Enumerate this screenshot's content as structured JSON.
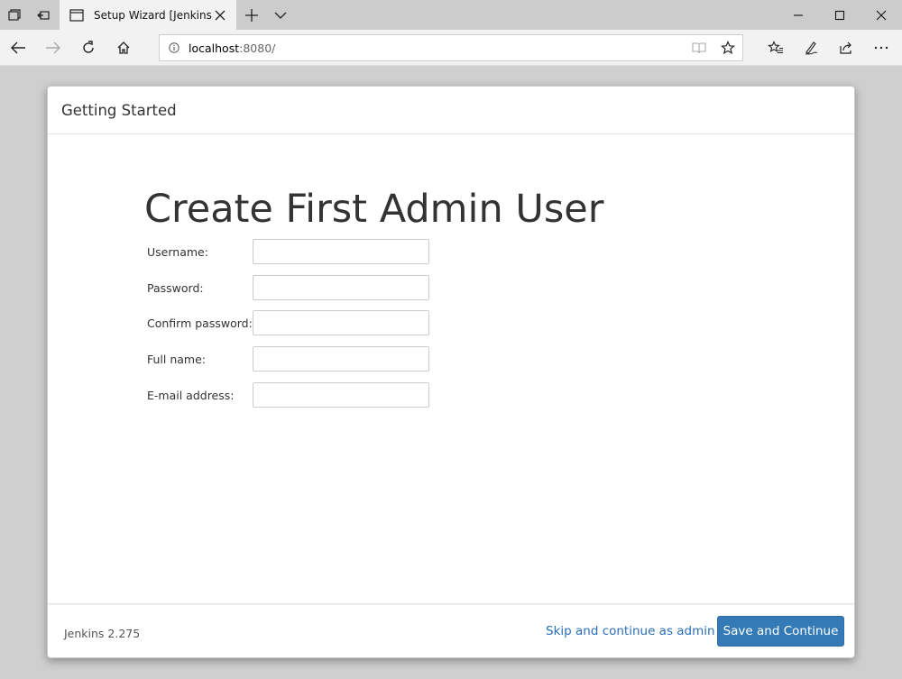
{
  "browser": {
    "tab_title": "Setup Wizard [Jenkins]",
    "url_host": "localhost",
    "url_rest": ":8080/"
  },
  "dialog": {
    "header_title": "Getting Started",
    "page_title": "Create First Admin User",
    "fields": [
      {
        "label": "Username:",
        "value": ""
      },
      {
        "label": "Password:",
        "value": ""
      },
      {
        "label": "Confirm password:",
        "value": ""
      },
      {
        "label": "Full name:",
        "value": ""
      },
      {
        "label": "E-mail address:",
        "value": ""
      }
    ],
    "footer": {
      "version": "Jenkins 2.275",
      "skip_label": "Skip and continue as admin",
      "save_label": "Save and Continue"
    }
  },
  "colors": {
    "primary_button": "#337ab7",
    "link": "#2a6ebb",
    "backdrop": "#cfcfcf"
  }
}
